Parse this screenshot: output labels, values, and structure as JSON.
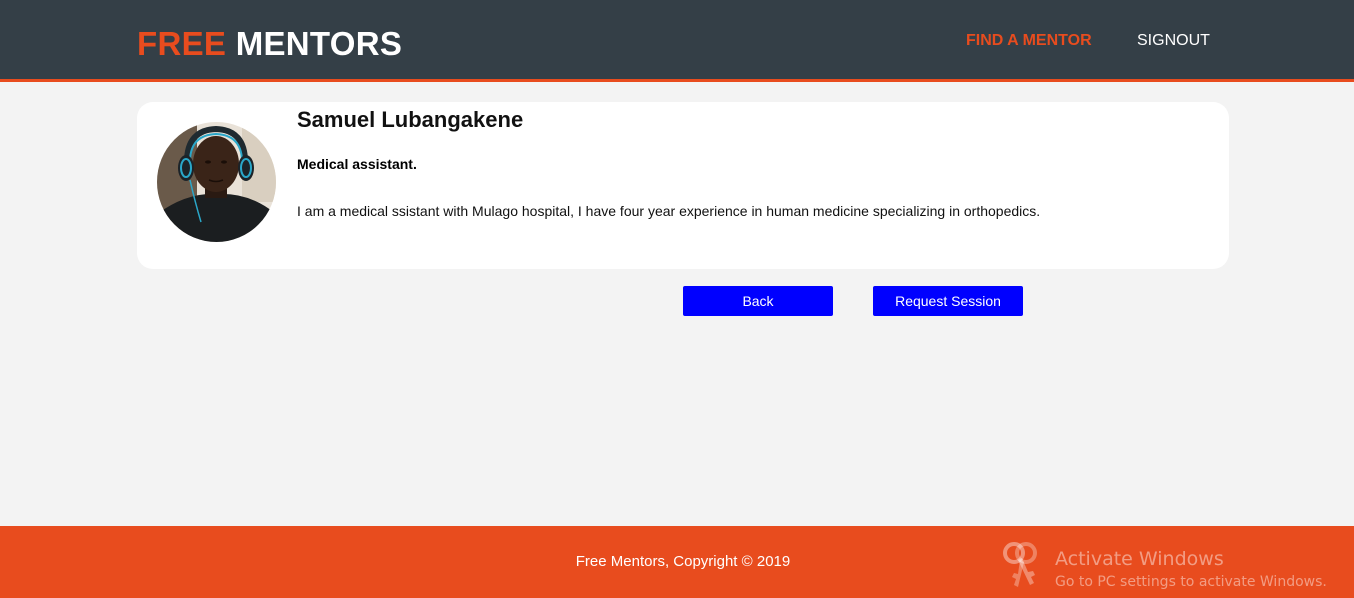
{
  "header": {
    "logo_free": "FREE",
    "logo_mentors": "MENTORS",
    "nav": {
      "find_mentor": "FIND A MENTOR",
      "signout": "SIGNOUT"
    }
  },
  "mentor": {
    "name": "Samuel Lubangakene",
    "title": "Medical assistant.",
    "bio": "I am a medical ssistant with Mulago hospital, I have four year experience in human medicine specializing in orthopedics."
  },
  "actions": {
    "back_label": "Back",
    "request_label": "Request Session"
  },
  "footer": {
    "copyright": "Free Mentors, Copyright © 2019"
  },
  "watermark": {
    "title": "Activate Windows",
    "subtitle": "Go to PC settings to activate Windows."
  },
  "colors": {
    "header_bg": "#343f47",
    "brand_orange": "#e84c1e",
    "button_blue": "#0000ff",
    "page_bg": "#f3f3f3"
  }
}
